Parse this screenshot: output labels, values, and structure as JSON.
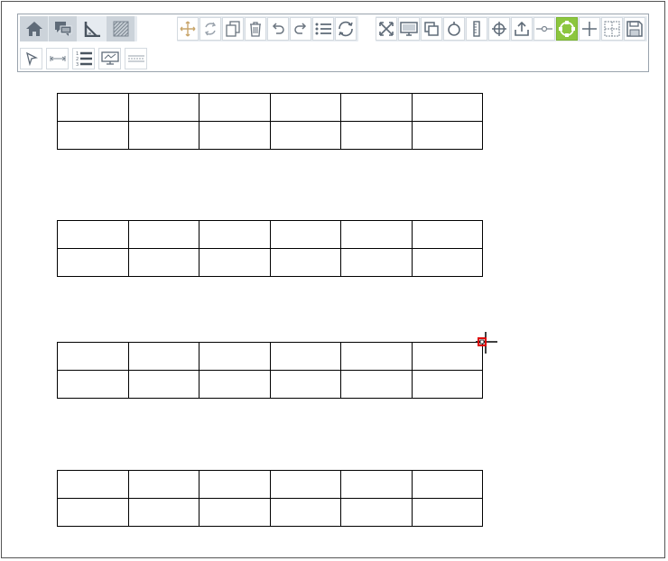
{
  "toolbar": {
    "group_main": [
      "home-icon",
      "chat-icon",
      "set-square-icon",
      "hatch-pattern-icon"
    ],
    "group_edit": [
      "move-icon",
      "rotate-icon",
      "copy-icon",
      "delete-icon",
      "undo-icon",
      "redo-icon",
      "list-icon",
      "refresh-icon"
    ],
    "group_view": [
      "fit-icon",
      "monitor-icon",
      "overlap-icon",
      "circle-icon",
      "ruler-icon",
      "target-icon",
      "export-icon",
      "line-point-icon",
      "circle-select-icon",
      "plus-icon",
      "grid-icon",
      "save-icon"
    ],
    "group_row2": [
      "pointer-icon",
      "dimension-icon",
      "numbered-list-icon",
      "screen-icon",
      "lines-icon"
    ],
    "active_tool": "circle-select-icon",
    "accent_color": "#8cc63f"
  },
  "canvas": {
    "tables": [
      {
        "rows": 2,
        "cols": 6
      },
      {
        "rows": 2,
        "cols": 6
      },
      {
        "rows": 2,
        "cols": 6
      },
      {
        "rows": 2,
        "cols": 6
      }
    ],
    "cursor": "crosshair-cursor-icon",
    "marker_color": "#dd0000"
  }
}
